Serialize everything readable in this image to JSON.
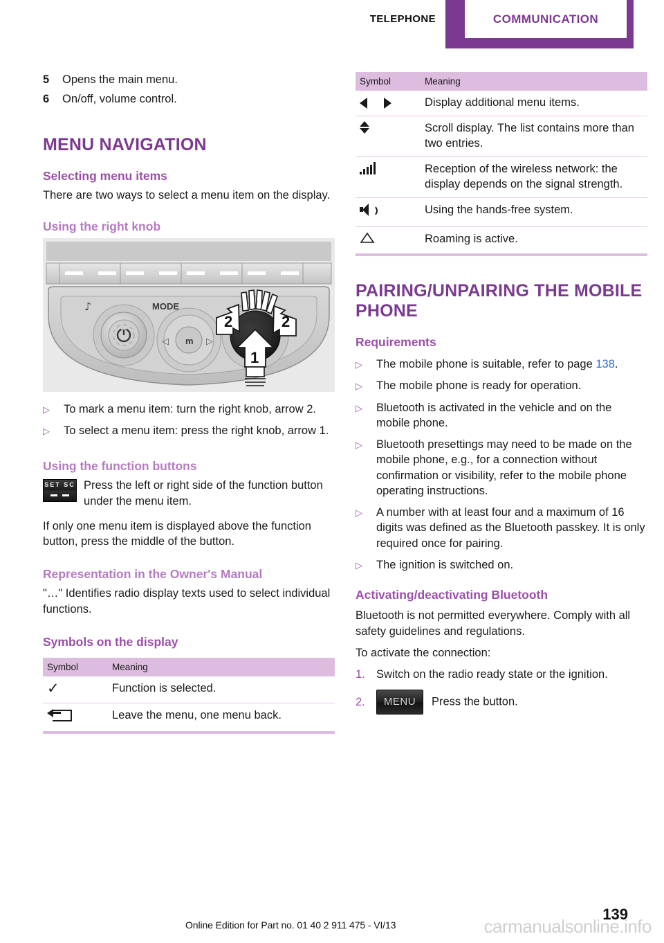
{
  "header": {
    "prev_chapter": "TELEPHONE",
    "current_chapter": "COMMUNICATION",
    "accent_color": "#7B3A8F"
  },
  "left_column": {
    "legend": [
      {
        "num": "5",
        "text": "Opens the main menu."
      },
      {
        "num": "6",
        "text": "On/off, volume control."
      }
    ],
    "section_title": "MENU NAVIGATION",
    "selecting": {
      "heading": "Selecting menu items",
      "body": "There are two ways to select a menu item on the display."
    },
    "right_knob": {
      "heading": "Using the right knob",
      "figure": {
        "name": "car-radio-control-panel",
        "mode_label": "MODE",
        "center_label": "m",
        "callout_1": "1",
        "callout_2a": "2",
        "callout_2b": "2"
      },
      "bullets": [
        "To mark a menu item: turn the right knob, arrow 2.",
        "To select a menu item: press the right knob, arrow 1."
      ]
    },
    "function_buttons": {
      "heading": "Using the function buttons",
      "button_label_top": "SET SC",
      "instruction": "Press the left or right side of the function button under the menu item.",
      "note": "If only one menu item is displayed above the function button, press the middle of the button."
    },
    "representation": {
      "heading": "Representation in the Owner's Manual",
      "body": "\"…\" Identifies radio display texts used to select individual functions."
    },
    "symbols_display": {
      "heading": "Symbols on the display",
      "table": {
        "columns": [
          "Symbol",
          "Meaning"
        ],
        "rows": [
          {
            "symbol": "checkmark-icon",
            "meaning": "Function is selected."
          },
          {
            "symbol": "back-arrow-icon",
            "meaning": "Leave the menu, one menu back."
          }
        ]
      }
    }
  },
  "right_column": {
    "symbols_table": {
      "columns": [
        "Symbol",
        "Meaning"
      ],
      "rows": [
        {
          "symbol": "left-right-triangles-icon",
          "meaning": "Display additional menu items."
        },
        {
          "symbol": "up-down-triangles-icon",
          "meaning": "Scroll display. The list contains more than two entries."
        },
        {
          "symbol": "signal-bars-icon",
          "meaning": "Reception of the wireless network: the display depends on the signal strength."
        },
        {
          "symbol": "speaker-icon",
          "meaning": "Using the hands-free system."
        },
        {
          "symbol": "roaming-triangle-icon",
          "meaning": "Roaming is active."
        }
      ]
    },
    "section_title": "PAIRING/UNPAIRING THE MOBILE PHONE",
    "requirements": {
      "heading": "Requirements",
      "items": [
        {
          "text_before": "The mobile phone is suitable, refer to page ",
          "pageref": "138",
          "text_after": "."
        },
        {
          "text_before": "The mobile phone is ready for operation.",
          "pageref": "",
          "text_after": ""
        },
        {
          "text_before": "Bluetooth is activated in the vehicle and on the mobile phone.",
          "pageref": "",
          "text_after": ""
        },
        {
          "text_before": "Bluetooth presettings may need to be made on the mobile phone, e.g., for a connection without confirmation or visibility, refer to the mobile phone operating instructions.",
          "pageref": "",
          "text_after": ""
        },
        {
          "text_before": "A number with at least four and a maximum of 16 digits was defined as the Bluetooth passkey. It is only required once for pairing.",
          "pageref": "",
          "text_after": ""
        },
        {
          "text_before": "The ignition is switched on.",
          "pageref": "",
          "text_after": ""
        }
      ]
    },
    "activating": {
      "heading": "Activating/deactivating Bluetooth",
      "body1": "Bluetooth is not permitted everywhere. Comply with all safety guidelines and regulations.",
      "body2": "To activate the connection:",
      "steps": [
        {
          "num": "1.",
          "text": "Switch on the radio ready state or the ignition.",
          "button": ""
        },
        {
          "num": "2.",
          "text": "Press the button.",
          "button": "MENU"
        }
      ]
    }
  },
  "footer": {
    "edition_line": "Online Edition for Part no. 01 40 2 911 475 - VI/13",
    "page_number": "139",
    "watermark": "carmanualsonline.info"
  }
}
